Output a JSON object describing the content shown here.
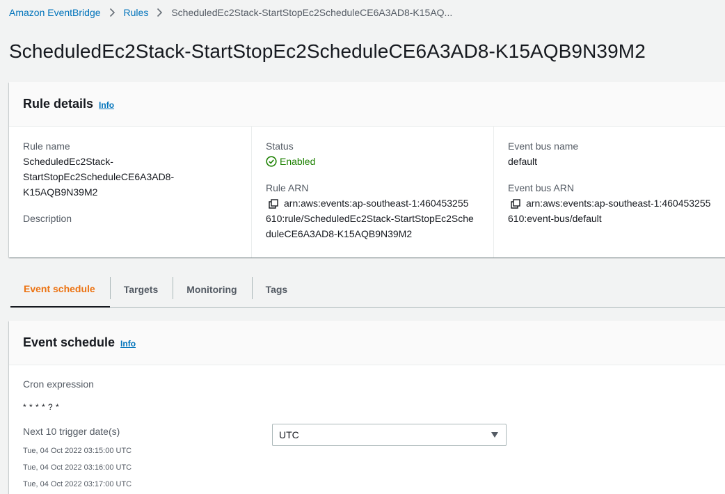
{
  "breadcrumb": {
    "items": [
      "Amazon EventBridge",
      "Rules"
    ],
    "current": "ScheduledEc2Stack-StartStopEc2ScheduleCE6A3AD8-K15AQ..."
  },
  "page_title": "ScheduledEc2Stack-StartStopEc2ScheduleCE6A3AD8-K15AQB9N39M2",
  "rule_details": {
    "title": "Rule details",
    "info": "Info",
    "rule_name_label": "Rule name",
    "rule_name_lines": [
      "ScheduledEc2Stack-",
      "StartStopEc2ScheduleCE6A3AD8-",
      "K15AQB9N39M2"
    ],
    "description_label": "Description",
    "status_label": "Status",
    "status_value": "Enabled",
    "rule_arn_label": "Rule ARN",
    "rule_arn_lines": [
      "arn:aws:events:ap-southeast-1:460453255",
      "610:rule/ScheduledEc2Stack-StartStopEc2Sche",
      "duleCE6A3AD8-K15AQB9N39M2"
    ],
    "event_bus_name_label": "Event bus name",
    "event_bus_name_value": "default",
    "event_bus_arn_label": "Event bus ARN",
    "event_bus_arn_lines": [
      "arn:aws:events:ap-southeast-1:460453255",
      "610:event-bus/default"
    ]
  },
  "tabs": [
    "Event schedule",
    "Targets",
    "Monitoring",
    "Tags"
  ],
  "event_schedule": {
    "title": "Event schedule",
    "info": "Info",
    "cron_label": "Cron expression",
    "cron_value": "* * * * ? *",
    "next_label": "Next 10 trigger date(s)",
    "dates": [
      "Tue, 04 Oct 2022 03:15:00 UTC",
      "Tue, 04 Oct 2022 03:16:00 UTC",
      "Tue, 04 Oct 2022 03:17:00 UTC"
    ],
    "timezone_selected": "UTC"
  },
  "colors": {
    "link": "#0073bb",
    "active_tab": "#ec7211",
    "success": "#1d8102"
  }
}
